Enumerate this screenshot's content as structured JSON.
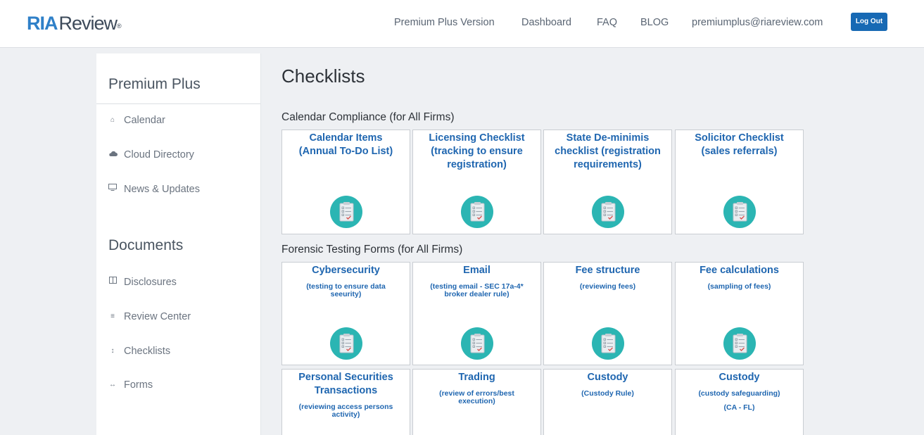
{
  "header": {
    "logo_ria": "RIA",
    "logo_review": "Review",
    "logo_tm": "®",
    "nav": [
      "Premium Plus Version",
      "Dashboard",
      "FAQ",
      "BLOG",
      "premiumplus@riareview.com"
    ],
    "logout_label": "Log Out"
  },
  "sidebar": {
    "premium_heading": "Premium Plus",
    "premium_items": [
      {
        "label": "Calendar",
        "icon": "home-icon"
      },
      {
        "label": "Cloud Directory",
        "icon": "cloud-icon"
      },
      {
        "label": "News & Updates",
        "icon": "monitor-icon"
      }
    ],
    "documents_heading": "Documents",
    "document_items": [
      {
        "label": "Disclosures",
        "icon": "columns-icon"
      },
      {
        "label": "Review Center",
        "icon": "menu-icon"
      },
      {
        "label": "Checklists",
        "icon": "vertical-arrows-icon"
      },
      {
        "label": "Forms",
        "icon": "horizontal-arrows-icon"
      }
    ]
  },
  "main": {
    "title": "Checklists",
    "sections": [
      {
        "heading": "Calendar Compliance (for All Firms)",
        "cards": [
          {
            "title": "Calendar Items (Annual To-Do List)"
          },
          {
            "title": "Licensing Checklist (tracking to ensure registration)"
          },
          {
            "title": "State De-minimis checklist (registration requirements)"
          },
          {
            "title": "Solicitor Checklist (sales referrals)"
          }
        ]
      },
      {
        "heading": "Forensic Testing Forms (for All Firms)",
        "cards": [
          {
            "title": "Cybersecurity",
            "subtitle": "(testing to ensure data seeurity)"
          },
          {
            "title": "Email",
            "subtitle": "(testing email - SEC 17a-4* broker dealer rule)"
          },
          {
            "title": "Fee structure",
            "subtitle": "(reviewing fees)"
          },
          {
            "title": "Fee calculations",
            "subtitle": "(sampling of fees)"
          },
          {
            "title": "Personal Securities Transactions",
            "subtitle": "(reviewing access persons activity)"
          },
          {
            "title": "Trading",
            "subtitle": "(review of errors/best execution)"
          },
          {
            "title": "Custody",
            "subtitle": "(Custody Rule)"
          },
          {
            "title": "Custody",
            "subtitle": "(custody safeguarding)",
            "subtitle2": "(CA - FL)"
          }
        ]
      }
    ]
  },
  "colors": {
    "accent_blue": "#1f66b0",
    "button_blue": "#1769b4",
    "icon_teal": "#2bb5b3"
  }
}
